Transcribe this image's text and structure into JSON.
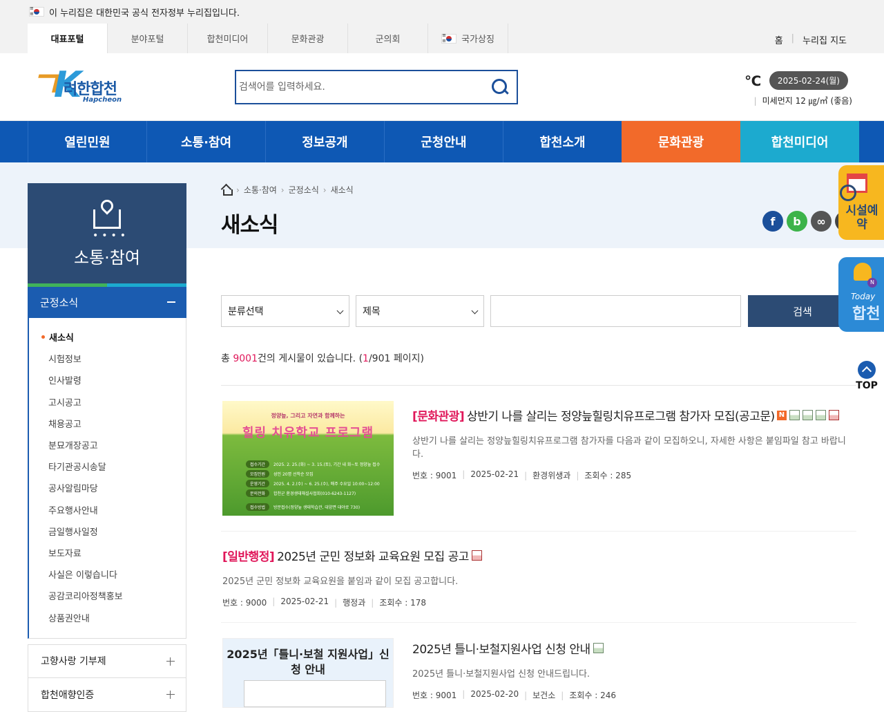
{
  "gov_banner": {
    "text": "이 누리집은 대한민국 공식 전자정부 누리집입니다."
  },
  "portal_tabs": [
    "대표포털",
    "분야포털",
    "합천미디어",
    "문화관광",
    "군의회",
    "국가상징"
  ],
  "utility_links": {
    "home": "홈",
    "sitemap": "누리집 지도"
  },
  "logo": {
    "title": "려한합천",
    "sub": "Hapcheon"
  },
  "search": {
    "placeholder": "검색어를 입력하세요."
  },
  "weather": {
    "temp_unit": "℃",
    "date": "2025-02-24(월)",
    "dust": "미세먼지 12 ㎍/㎥ (좋음)"
  },
  "main_nav": [
    "열린민원",
    "소통·참여",
    "정보공개",
    "군청안내",
    "합천소개",
    "문화관광",
    "합천미디어"
  ],
  "sidebar": {
    "title": "소통·참여",
    "current": "군정소식",
    "sub_items": [
      "새소식",
      "시험정보",
      "인사발령",
      "고시공고",
      "채용공고",
      "분묘개장공고",
      "타기관공시송달",
      "공사알림마당",
      "주요행사안내",
      "금일행사일정",
      "보도자료",
      "사실은 이렇습니다",
      "공감코리아정책홍보",
      "상품권안내"
    ],
    "groups": [
      "고향사랑 기부제",
      "합천애향인증"
    ]
  },
  "breadcrumb": [
    "소통·참여",
    "군정소식",
    "새소식"
  ],
  "page_title": "새소식",
  "filter": {
    "category": "분류선택",
    "field": "제목",
    "search_button": "검색"
  },
  "total": {
    "prefix": "총 ",
    "count": "9001",
    "middle": "건의 게시물이 있습니다. (",
    "page": "1",
    "suffix": "/901 페이지)"
  },
  "posts": [
    {
      "category": "[문화관광]",
      "title": "상반기 나를 살리는 정양늪힐링치유프로그램 참가자 모집(공고문)",
      "desc": "상반기 나를 살리는 정양늪힐링치유프로그램 참가자를 다음과 같이 모집하오니, 자세한 사항은 붙임파일 참고 바랍니다.",
      "no": "번호 : 9001",
      "date": "2025-02-21",
      "dept": "환경위생과",
      "views": "조회수 : 285",
      "thumb": {
        "top": "정양늪, 그리고 자연과 함께하는",
        "title": "힐링 치유학교 프로그램",
        "rows": [
          {
            "k": "접수기간",
            "v": "2025. 2. 25.(화) ~ 3. 15.(토), 기간 내 화~토 정양늪 접수"
          },
          {
            "k": "모집인원",
            "v": "성인 20명 선착순 모집"
          },
          {
            "k": "운영기간",
            "v": "2025. 4. 2.(수) ~ 6. 25.(수), 매주 수요일 10:00~12:00"
          },
          {
            "k": "문의전화",
            "v": "합천군 환경생태해설사협회(010-6243-1127)"
          },
          {
            "k": "접수방법",
            "v": "방문접수(정양늪 생태학습관, 대양면 대야로 730)"
          }
        ]
      }
    },
    {
      "category": "[일반행정]",
      "title": "2025년 군민 정보화 교육요원 모집 공고",
      "desc": "2025년 군민 정보화 교육요원을 붙임과 같이 모집 공고합니다.",
      "no": "번호 : 9000",
      "date": "2025-02-21",
      "dept": "행정과",
      "views": "조회수 : 178"
    },
    {
      "category": "",
      "title": "2025년 틀니·보철지원사업 신청 안내",
      "desc": "2025년 틀니·보철지원사업 신청 안내드립니다.",
      "no": "번호 : 9001",
      "date": "2025-02-20",
      "dept": "보건소",
      "views": "조회수 : 246",
      "thumb": {
        "title": "2025년「틀니·보철 지원사업」신청 안내"
      }
    }
  ],
  "floating": {
    "reserve": "시설예약",
    "today_en": "Today",
    "today_ko": "합천",
    "top": "TOP",
    "new_badge": "N"
  },
  "colors": {
    "nav_blue": "#0e58b4",
    "nav_orange": "#f26a2a",
    "nav_teal": "#1caacf",
    "sidebar_navy": "#2c4b74",
    "accent_red": "#e0175a"
  }
}
